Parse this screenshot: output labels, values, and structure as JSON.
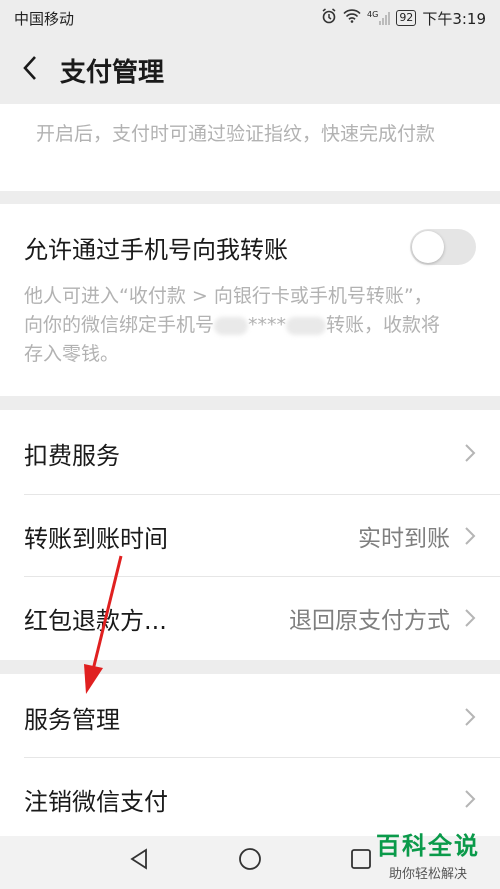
{
  "status": {
    "carrier": "中国移动",
    "battery": "92",
    "time": "下午3:19",
    "network": "4G"
  },
  "header": {
    "title": "支付管理"
  },
  "fingerprint": {
    "desc": "开启后，支付时可通过验证指纹，快速完成付款"
  },
  "phone_transfer": {
    "label": "允许通过手机号向我转账",
    "enabled": false,
    "desc_part1": "他人可进入“收付款 > 向银行卡或手机号转账”，向你的微信绑定手机号",
    "desc_masked": "****",
    "desc_part2": "转账，收款将存入零钱。"
  },
  "settings": {
    "deduction": "扣费服务",
    "transfer_time": "转账到账时间",
    "transfer_time_value": "实时到账",
    "red_packet": "红包退款方...",
    "red_packet_value": "退回原支付方式",
    "service_mgmt": "服务管理",
    "cancel_pay": "注销微信支付"
  },
  "watermark": {
    "title": "百科全说",
    "subtitle": "助你轻松解决"
  },
  "colors": {
    "accent_arrow": "#e02020",
    "watermark_green": "#0a9a4a"
  }
}
